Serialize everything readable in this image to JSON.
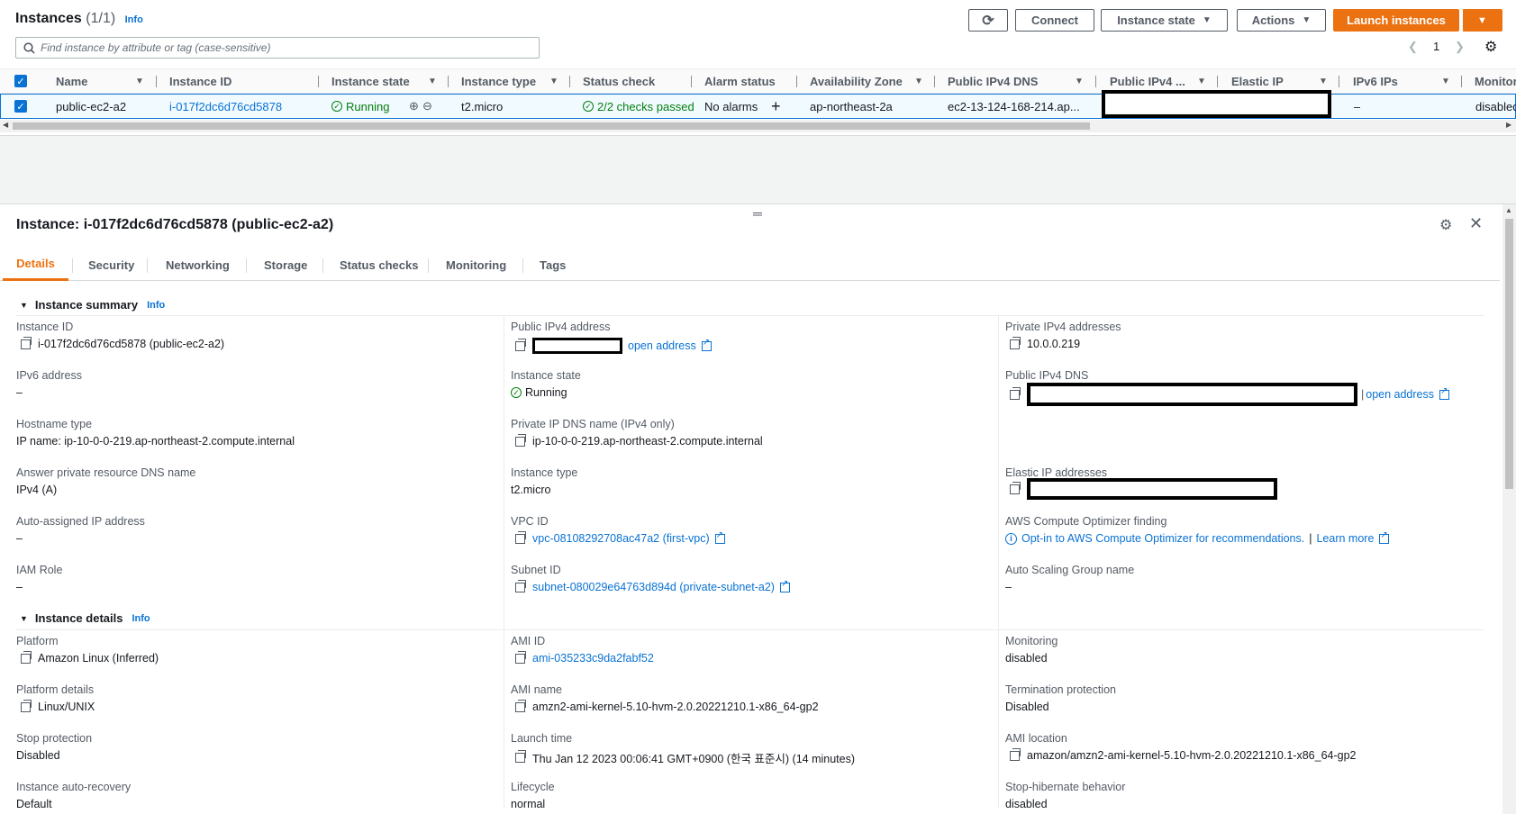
{
  "list": {
    "title": "Instances",
    "count": "(1/1)",
    "info": "Info",
    "buttons": {
      "connect": "Connect",
      "instance_state": "Instance state",
      "actions": "Actions",
      "launch": "Launch instances"
    },
    "search_placeholder": "Find instance by attribute or tag (case-sensitive)",
    "page": "1",
    "columns": [
      "Name",
      "Instance ID",
      "Instance state",
      "Instance type",
      "Status check",
      "Alarm status",
      "Availability Zone",
      "Public IPv4 DNS",
      "Public IPv4 ...",
      "Elastic IP",
      "IPv6 IPs",
      "Monitor"
    ],
    "row": {
      "name": "public-ec2-a2",
      "instance_id": "i-017f2dc6d76cd5878",
      "state": "Running",
      "type": "t2.micro",
      "status_check": "2/2 checks passed",
      "alarm": "No alarms",
      "az": "ap-northeast-2a",
      "dns": "ec2-13-124-168-214.ap...",
      "ipv6": "–",
      "monitoring": "disabled"
    }
  },
  "detail": {
    "title": "Instance: i-017f2dc6d76cd5878 (public-ec2-a2)",
    "tabs": [
      "Details",
      "Security",
      "Networking",
      "Storage",
      "Status checks",
      "Monitoring",
      "Tags"
    ],
    "summary": {
      "title": "Instance summary",
      "info": "Info",
      "instance_id_label": "Instance ID",
      "instance_id": "i-017f2dc6d76cd5878 (public-ec2-a2)",
      "ipv6_label": "IPv6 address",
      "ipv6": "–",
      "hostname_type_label": "Hostname type",
      "hostname_type": "IP name: ip-10-0-0-219.ap-northeast-2.compute.internal",
      "answer_dns_label": "Answer private resource DNS name",
      "answer_dns": "IPv4 (A)",
      "auto_ip_label": "Auto-assigned IP address",
      "auto_ip": "–",
      "iam_label": "IAM Role",
      "iam": "–",
      "public_ipv4_label": "Public IPv4 address",
      "open_address": "open address",
      "state_label": "Instance state",
      "state": "Running",
      "private_dns_label": "Private IP DNS name (IPv4 only)",
      "private_dns": "ip-10-0-0-219.ap-northeast-2.compute.internal",
      "type_label": "Instance type",
      "type": "t2.micro",
      "vpc_label": "VPC ID",
      "vpc": "vpc-08108292708ac47a2 (first-vpc)",
      "subnet_label": "Subnet ID",
      "subnet": "subnet-080029e64763d894d (private-subnet-a2)",
      "private_ipv4_label": "Private IPv4 addresses",
      "private_ipv4": "10.0.0.219",
      "public_dns_label": "Public IPv4 DNS",
      "elastic_label": "Elastic IP addresses",
      "optimizer_label": "AWS Compute Optimizer finding",
      "optimizer": "Opt-in to AWS Compute Optimizer for recommendations.",
      "learn_more": "Learn more",
      "asg_label": "Auto Scaling Group name",
      "asg": "–"
    },
    "details": {
      "title": "Instance details",
      "info": "Info",
      "platform_label": "Platform",
      "platform": "Amazon Linux (Inferred)",
      "platform_details_label": "Platform details",
      "platform_details": "Linux/UNIX",
      "stop_protection_label": "Stop protection",
      "stop_protection": "Disabled",
      "auto_recovery_label": "Instance auto-recovery",
      "auto_recovery": "Default",
      "ami_id_label": "AMI ID",
      "ami_id": "ami-035233c9da2fabf52",
      "ami_name_label": "AMI name",
      "ami_name": "amzn2-ami-kernel-5.10-hvm-2.0.20221210.1-x86_64-gp2",
      "launch_label": "Launch time",
      "launch": "Thu Jan 12 2023 00:06:41 GMT+0900 (한국 표준시) (14 minutes)",
      "lifecycle_label": "Lifecycle",
      "lifecycle": "normal",
      "monitoring_label": "Monitoring",
      "monitoring": "disabled",
      "termination_label": "Termination protection",
      "termination": "Disabled",
      "ami_location_label": "AMI location",
      "ami_location": "amazon/amzn2-ami-kernel-5.10-hvm-2.0.20221210.1-x86_64-gp2",
      "hibernate_label": "Stop-hibernate behavior",
      "hibernate": "disabled"
    }
  }
}
